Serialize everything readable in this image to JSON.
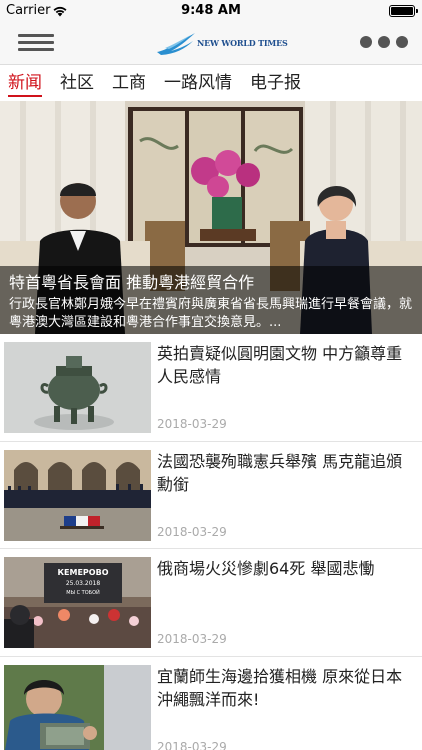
{
  "status_bar": {
    "carrier": "Carrier",
    "time": "9:48 AM"
  },
  "header": {
    "logo_text": "NEW WORLD TIMES",
    "menu_icon": "hamburger-menu-icon",
    "more_icon": "more-dots-icon"
  },
  "tabs": [
    {
      "label": "新闻",
      "active": true
    },
    {
      "label": "社区",
      "active": false
    },
    {
      "label": "工商",
      "active": false
    },
    {
      "label": "一路风情",
      "active": false
    },
    {
      "label": "电子报",
      "active": false
    }
  ],
  "hero": {
    "title": "特首粵省長會面 推動粵港經貿合作",
    "summary": "行政長官林鄭月娥今早在禮賓府與廣東省省長馬興瑞進行早餐會議，就粵港澳大灣區建設和粵港合作事宜交換意見。..."
  },
  "articles": [
    {
      "title": "英拍賣疑似圓明園文物 中方籲尊重人民感情",
      "date": "2018-03-29"
    },
    {
      "title": "法國恐襲殉職憲兵舉殯 馬克龍追頒勳銜",
      "date": "2018-03-29"
    },
    {
      "title": "俄商場火災慘劇64死 舉國悲慟",
      "date": "2018-03-29"
    },
    {
      "title": "宜蘭師生海邊拾獲相機 原來從日本沖繩飄洋而來!",
      "date": "2018-03-29"
    }
  ],
  "thumb_signs": {
    "kemerovo": "КЕМЕРОВО",
    "kemerovo_date": "25.03.2018",
    "kemerovo_line": "МЫ С ТОБОЙ"
  },
  "colors": {
    "accent": "#d0121b",
    "header_bg": "#f7f7f7",
    "date": "#aaaaaa"
  }
}
